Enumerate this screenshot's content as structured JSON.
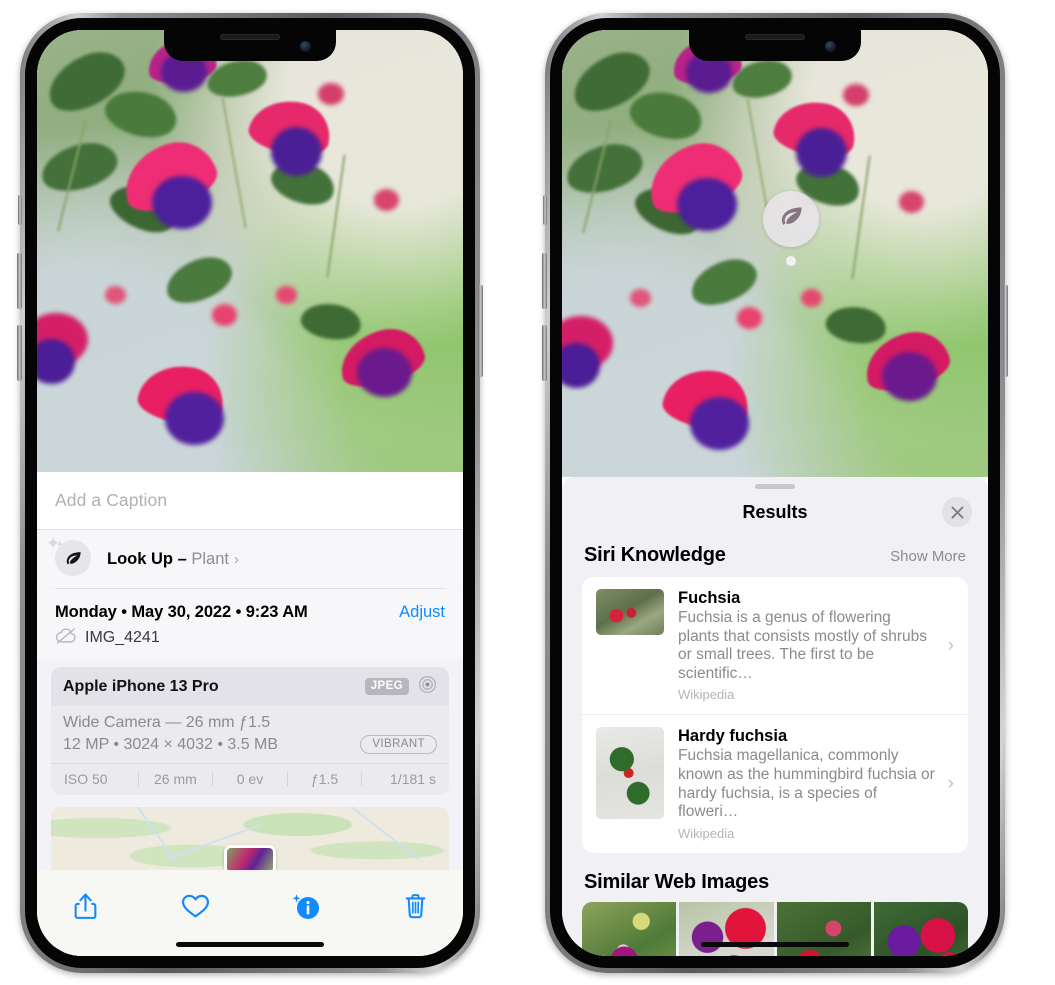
{
  "left_phone": {
    "photo_alt": "fuchsia-flowers-photo",
    "caption": {
      "placeholder": "Add a Caption",
      "value": ""
    },
    "lookup_row": {
      "icon": "leaf-icon",
      "label": "Look Up – ",
      "subject": "Plant",
      "chevron": "›"
    },
    "meta": {
      "date": "Monday • May 30, 2022 • 9:23 AM",
      "adjust_label": "Adjust",
      "cloud_icon": "icloud-slash-icon",
      "filename": "IMG_4241"
    },
    "exif": {
      "device": "Apple iPhone 13 Pro",
      "format_badge": "JPEG",
      "aperture_icon": "aperture-icon",
      "lens": "Wide Camera — 26 mm ƒ1.5",
      "size_line": "12 MP • 3024 × 4032 • 3.5 MB",
      "style_badge": "VIBRANT",
      "stats": [
        "ISO 50",
        "26 mm",
        "0 ev",
        "ƒ1.5",
        "1/181 s"
      ]
    },
    "map": {
      "pin": "photo-pin-thumbnail"
    },
    "toolbar": [
      {
        "name": "share-icon",
        "label": "Share"
      },
      {
        "name": "heart-icon",
        "label": "Favorite"
      },
      {
        "name": "info-sparkle-icon",
        "label": "Info"
      },
      {
        "name": "trash-icon",
        "label": "Delete"
      }
    ]
  },
  "right_phone": {
    "visual_lookup_badge": {
      "icon": "leaf-icon"
    },
    "sheet": {
      "title": "Results",
      "close_icon": "close-icon",
      "siri_knowledge": {
        "heading": "Siri Knowledge",
        "show_more": "Show More",
        "items": [
          {
            "title": "Fuchsia",
            "description": "Fuchsia is a genus of flowering plants that consists mostly of shrubs or small trees. The first to be scientific…",
            "source": "Wikipedia",
            "thumb": "fuchsia-thumbnail",
            "chevron": "›"
          },
          {
            "title": "Hardy fuchsia",
            "description": "Fuchsia magellanica, commonly known as the hummingbird fuchsia or hardy fuchsia, is a species of floweri…",
            "source": "Wikipedia",
            "thumb": "hardy-fuchsia-thumbnail",
            "chevron": "›"
          }
        ]
      },
      "similar_web_images": {
        "heading": "Similar Web Images",
        "thumbs": [
          "web-image-1",
          "web-image-2",
          "web-image-3",
          "web-image-4"
        ]
      }
    }
  },
  "colors": {
    "accent_blue": "#1289fd",
    "sheet_bg": "#f1f1f5",
    "card_bg": "#ffffff",
    "secondary_text": "#8a8a90"
  }
}
